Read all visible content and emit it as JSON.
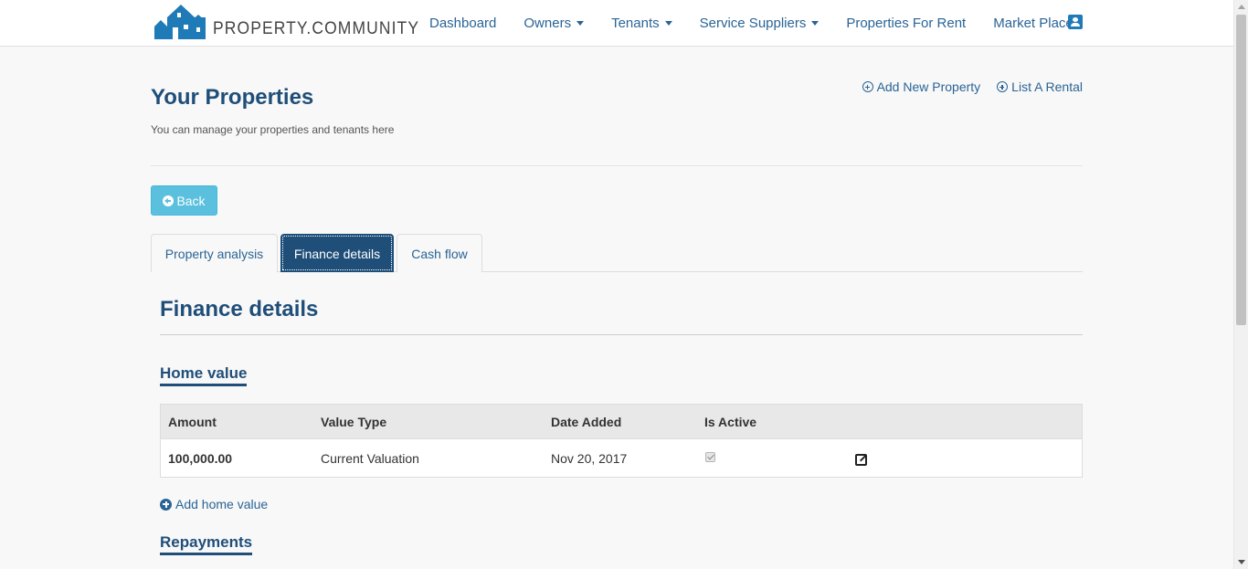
{
  "brand": {
    "name": "PROPERTY.COMMUNITY"
  },
  "nav": {
    "items": [
      {
        "label": "Dashboard",
        "dropdown": false
      },
      {
        "label": "Owners",
        "dropdown": true
      },
      {
        "label": "Tenants",
        "dropdown": true
      },
      {
        "label": "Service Suppliers",
        "dropdown": true
      },
      {
        "label": "Properties For Rent",
        "dropdown": false
      },
      {
        "label": "Market Place",
        "dropdown": false
      }
    ],
    "user_icon": "user-card-icon"
  },
  "header": {
    "title": "Your Properties",
    "subtitle": "You can manage your properties and tenants here",
    "actions": {
      "add_property": "Add New Property",
      "list_rental": "List A Rental"
    }
  },
  "back_label": "Back",
  "tabs": [
    {
      "label": "Property analysis",
      "active": false
    },
    {
      "label": "Finance details",
      "active": true
    },
    {
      "label": "Cash flow",
      "active": false
    }
  ],
  "finance": {
    "title": "Finance details",
    "home_value": {
      "title": "Home value",
      "columns": [
        "Amount",
        "Value Type",
        "Date Added",
        "Is Active"
      ],
      "rows": [
        {
          "amount": "100,000.00",
          "value_type": "Current Valuation",
          "date_added": "Nov 20, 2017",
          "is_active": true
        }
      ],
      "add_label": "Add home value"
    },
    "repayments": {
      "title": "Repayments"
    }
  },
  "colors": {
    "primary": "#1f4e79",
    "link": "#2a6496",
    "info_button": "#5bc0de",
    "background": "#f8f8f8"
  }
}
